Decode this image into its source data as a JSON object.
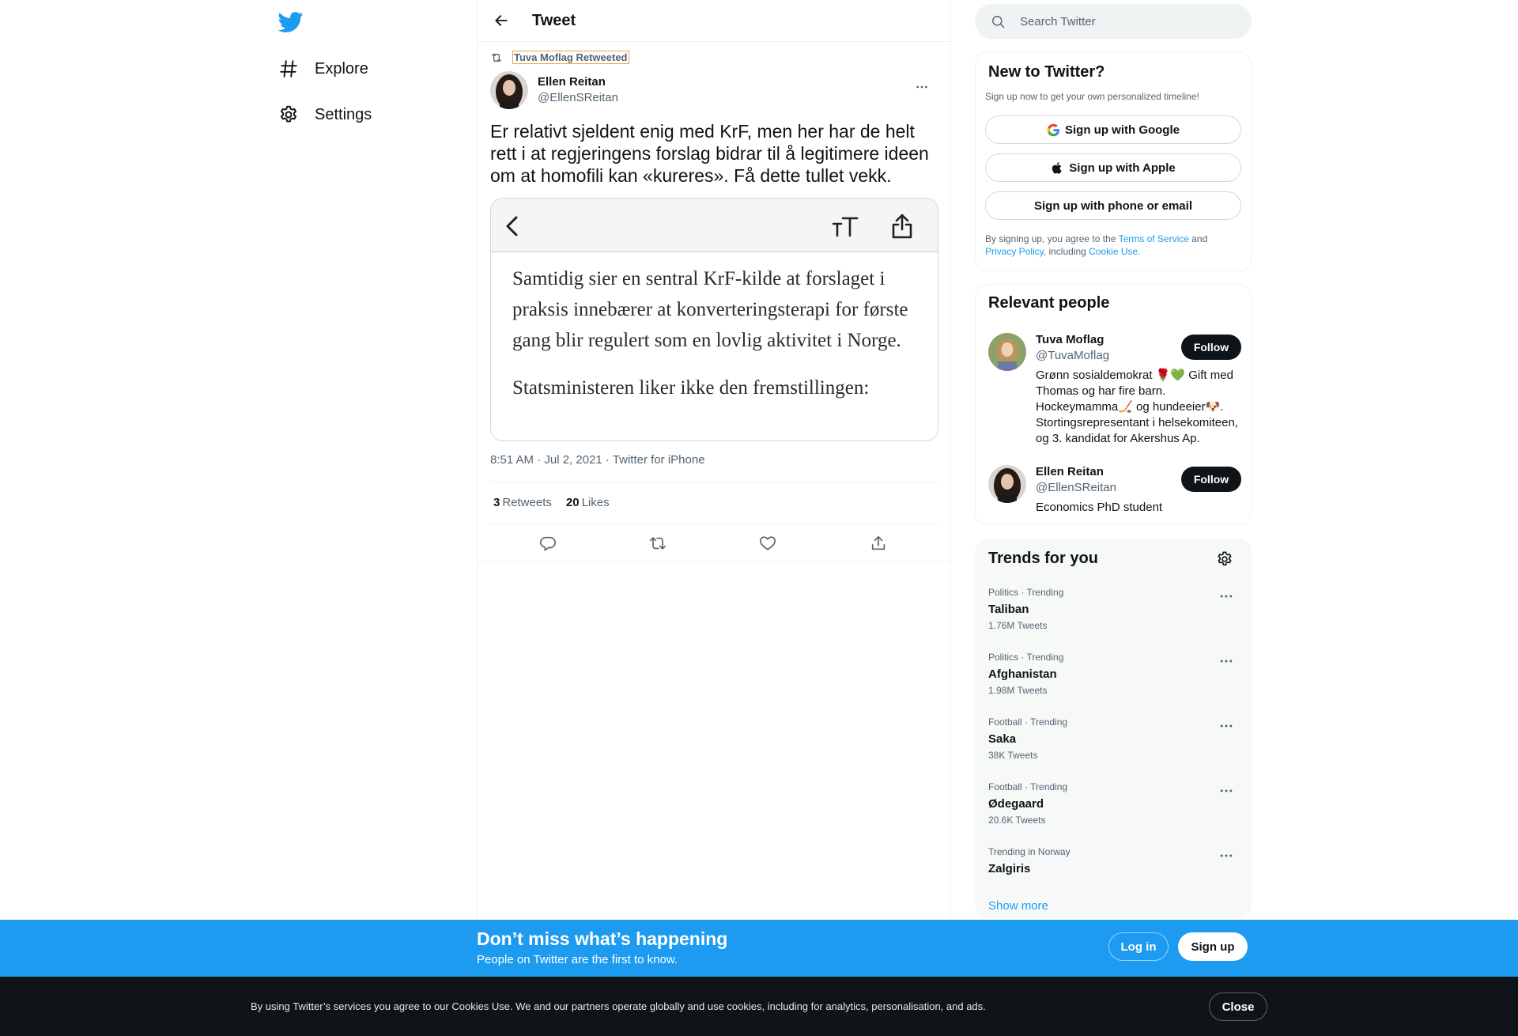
{
  "colors": {
    "brand": "#1d9bf0",
    "text_primary": "#0f1419",
    "text_secondary": "#536471",
    "dark_bar": "#0f1419"
  },
  "nav": {
    "logo_icon": "twitter-bird-icon",
    "items": [
      {
        "label": "Explore",
        "icon": "hashtag-icon"
      },
      {
        "label": "Settings",
        "icon": "gear-icon"
      }
    ]
  },
  "header": {
    "title": "Tweet"
  },
  "tweet": {
    "retweeted_by": "Tuva Moflag Retweeted",
    "author_name": "Ellen Reitan",
    "author_handle": "@EllenSReitan",
    "text": "Er relativt sjeldent enig med KrF, men her har de helt rett i at regjeringens forslag bidrar til å legitimere ideen om at homofili kan «kureres». Få dette tullet vekk.",
    "media": {
      "paragraph1": "Samtidig sier en sentral KrF-kilde at forslaget i praksis innebærer at konverteringsterapi for første gang blir regulert som en lovlig aktivitet i Norge.",
      "paragraph2": "Statsministeren liker ikke den fremstillingen:"
    },
    "timestamp": "8:51 AM · Jul 2, 2021 · Twitter for iPhone",
    "retweets_count": "3",
    "retweets_label": "Retweets",
    "likes_count": "20",
    "likes_label": "Likes"
  },
  "search": {
    "placeholder": "Search Twitter"
  },
  "signup_card": {
    "title": "New to Twitter?",
    "subtitle": "Sign up now to get your own personalized timeline!",
    "google": "Sign up with Google",
    "apple": "Sign up with Apple",
    "phone": "Sign up with phone or email",
    "terms_1": "By signing up, you agree to the ",
    "terms_link1": "Terms of Service",
    "terms_2": " and ",
    "terms_link2": "Privacy Policy",
    "terms_3": ", including ",
    "terms_link3": "Cookie Use."
  },
  "people": {
    "title": "Relevant people",
    "list": [
      {
        "name": "Tuva Moflag",
        "handle": "@TuvaMoflag",
        "bio": "Grønn sosialdemokrat 🌹💚 Gift med Thomas og har fire barn. Hockeymamma🏒 og hundeeier🐶. Stortingsrepresentant i helsekomiteen, og 3. kandidat for Akershus Ap.",
        "follow": "Follow"
      },
      {
        "name": "Ellen Reitan",
        "handle": "@EllenSReitan",
        "bio": "Economics PhD student",
        "follow": "Follow"
      }
    ]
  },
  "trends": {
    "title": "Trends for you",
    "items": [
      {
        "meta": "Politics · Trending",
        "name": "Taliban",
        "count": "1.76M Tweets"
      },
      {
        "meta": "Politics · Trending",
        "name": "Afghanistan",
        "count": "1.98M Tweets"
      },
      {
        "meta": "Football · Trending",
        "name": "Saka",
        "count": "38K Tweets"
      },
      {
        "meta": "Football · Trending",
        "name": "Ødegaard",
        "count": "20.6K Tweets"
      },
      {
        "meta": "Trending in Norway",
        "name": "Zalgiris",
        "count": ""
      }
    ],
    "show_more": "Show more"
  },
  "promo": {
    "title": "Don’t miss what’s happening",
    "subtitle": "People on Twitter are the first to know.",
    "login": "Log in",
    "signup": "Sign up"
  },
  "cookie": {
    "text": "By using Twitter’s services you agree to our Cookies Use. We and our partners operate globally and use cookies, including for analytics, personalisation, and ads.",
    "close": "Close"
  }
}
